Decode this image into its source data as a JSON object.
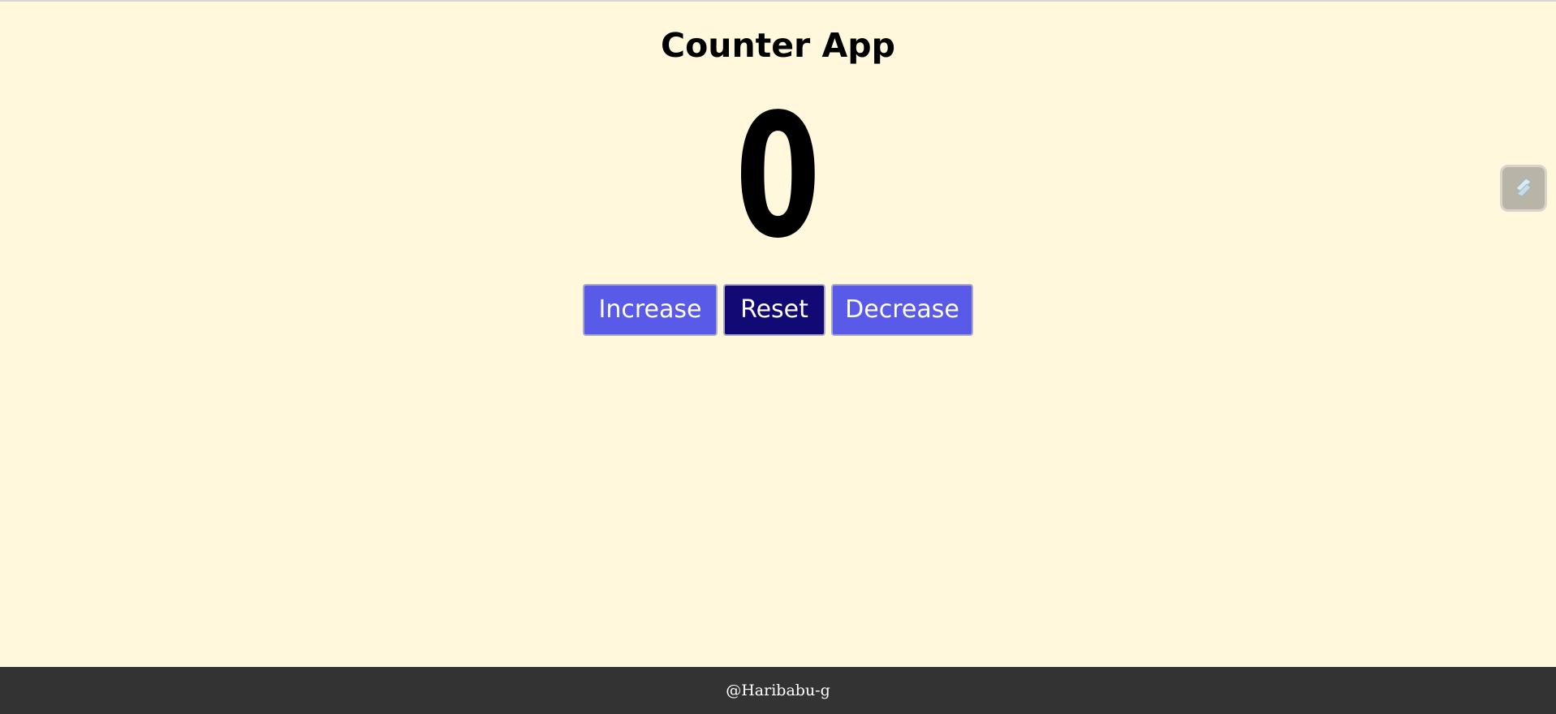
{
  "app": {
    "title": "Counter App",
    "count": "0"
  },
  "buttons": {
    "increase_label": "Increase",
    "reset_label": "Reset",
    "decrease_label": "Decrease"
  },
  "side_widget": {
    "icon": "extension-icon"
  },
  "footer": {
    "credit": "@Haribabu-g"
  },
  "colors": {
    "background": "#FFF8DC",
    "button_primary": "#5A5AE8",
    "button_reset": "#110A74",
    "footer_bg": "#333333"
  }
}
